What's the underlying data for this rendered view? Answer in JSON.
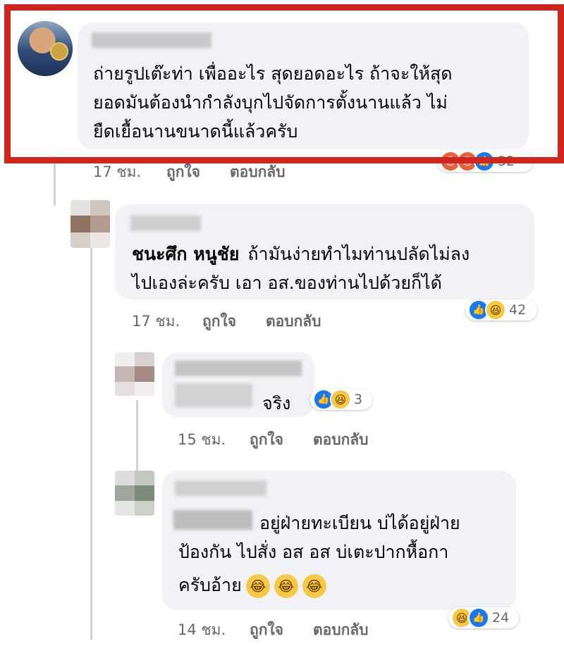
{
  "comments": [
    {
      "text_lines": [
        "ถ่ายรูปเต๊ะท่า เพื่ออะไร สุดยอดอะไร ถ้าจะให้สุด",
        "ยอดมันต้องนำกำลังบุกไปจัดการตั้งนานแล้ว ไม่",
        "ยืดเยื้อนานขนาดนี้แล้วครับ"
      ],
      "time": "17 ชม.",
      "like_label": "ถูกใจ",
      "reply_label": "ตอบกลับ",
      "reaction_count": "32",
      "reactions": [
        "angry-icon",
        "angry-icon",
        "like-icon"
      ]
    },
    {
      "tagged_name": "ชนะศึก หนูชัย",
      "text_first": "ถ้ามันง่ายทำไมท่านปลัดไม่ลง",
      "text_second": "ไปเองล่ะครับ เอา อส.ของท่านไปด้วยก็ได้",
      "time": "17 ชม.",
      "like_label": "ถูกใจ",
      "reply_label": "ตอบกลับ",
      "reaction_count": "42",
      "reactions": [
        "like-icon",
        "haha-icon"
      ]
    },
    {
      "text": "จริง",
      "time": "15 ชม.",
      "like_label": "ถูกใจ",
      "reply_label": "ตอบกลับ",
      "reaction_count": "3",
      "reactions": [
        "like-icon",
        "haha-icon"
      ]
    },
    {
      "text_lines": [
        "อยู่ฝ่ายทะเบียน บ่ได้อยู่ฝ่าย",
        "ป้องกัน ไปสั่ง อส อส บ่เตะปากหื้อกา",
        "ครับอ้าย"
      ],
      "emoji_count_shown": 3,
      "time": "14 ชม.",
      "like_label": "ถูกใจ",
      "reply_label": "ตอบกลับ",
      "reaction_count": "24",
      "reactions": [
        "haha-icon",
        "like-icon"
      ]
    }
  ],
  "colors": {
    "highlight_border": "#d0241c",
    "bubble": "#f0f2f5",
    "meta_text": "#65676b",
    "like_blue": "#1877f2",
    "haha_yellow": "#f7c844"
  }
}
